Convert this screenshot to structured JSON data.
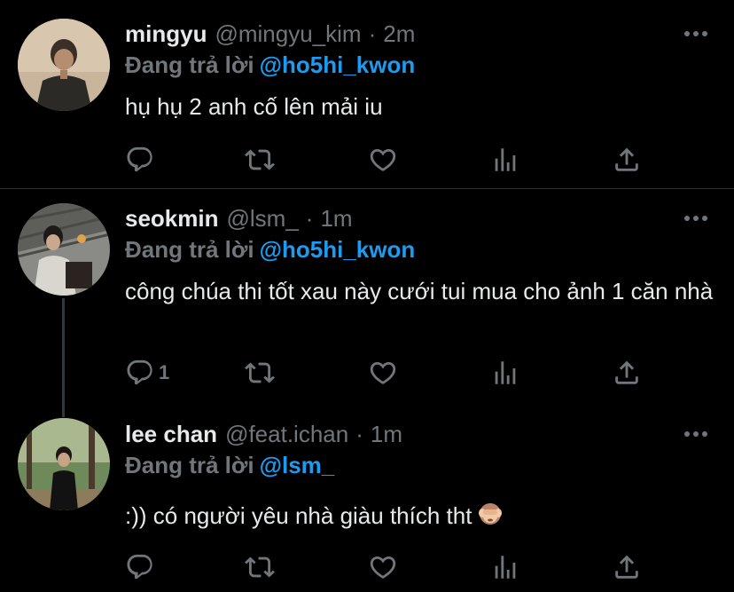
{
  "tweets": [
    {
      "name": "mingyu",
      "handle": "@mingyu_kim",
      "dot": "·",
      "time": "2m",
      "reply_prefix": "Đang trả lời",
      "reply_to": "@ho5hi_kwon",
      "text": "hụ hụ 2 anh cố lên mải iu",
      "reply_count": ""
    },
    {
      "name": "seokmin",
      "handle": "@lsm_",
      "dot": "·",
      "time": "1m",
      "reply_prefix": "Đang trả lời",
      "reply_to": "@ho5hi_kwon",
      "text": "công chúa thi tốt xau này cưới tui mua cho ảnh 1 căn nhà",
      "reply_count": "1"
    },
    {
      "name": "lee chan",
      "handle": "@feat.ichan",
      "dot": "·",
      "time": "1m",
      "reply_prefix": "Đang trả lời",
      "reply_to": "@lsm_",
      "text": ":)) có người yêu nhà giàu thích tht",
      "emoji": "see-no-evil-monkey",
      "reply_count": ""
    }
  ],
  "icons": [
    "reply-icon",
    "retweet-icon",
    "like-icon",
    "analytics-icon",
    "share-icon",
    "more-icon"
  ],
  "colors": {
    "background": "#000000",
    "text": "#e7e9ea",
    "secondary": "#71767b",
    "accent": "#1d9bf0",
    "divider": "#2f3336"
  }
}
